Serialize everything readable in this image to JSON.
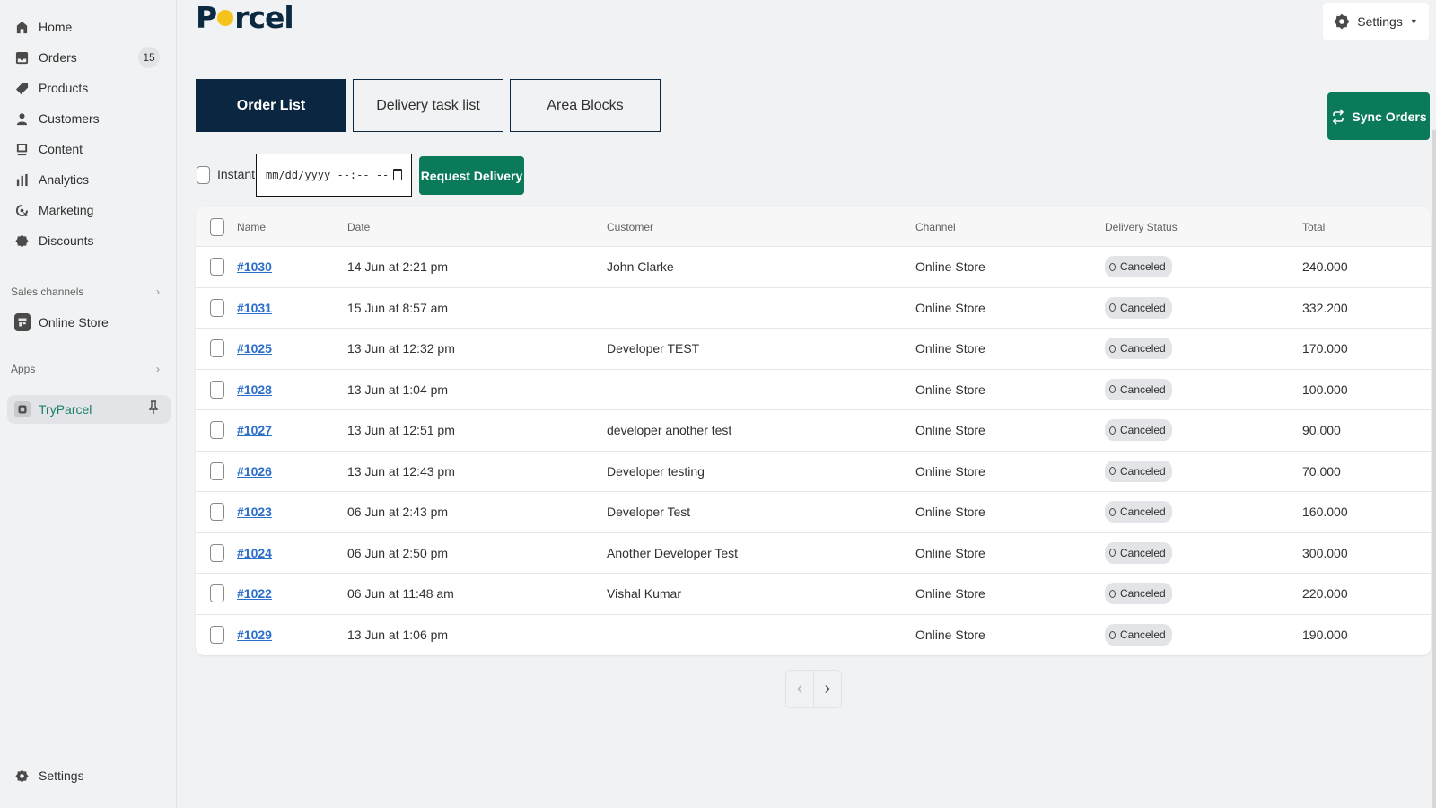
{
  "sidebar": {
    "items": [
      {
        "label": "Home",
        "icon": "home-icon"
      },
      {
        "label": "Orders",
        "icon": "orders-icon",
        "count": "15"
      },
      {
        "label": "Products",
        "icon": "tag-icon"
      },
      {
        "label": "Customers",
        "icon": "person-icon"
      },
      {
        "label": "Content",
        "icon": "content-icon"
      },
      {
        "label": "Analytics",
        "icon": "bar-chart-icon"
      },
      {
        "label": "Marketing",
        "icon": "target-icon"
      },
      {
        "label": "Discounts",
        "icon": "discount-icon"
      }
    ],
    "sales_channels_label": "Sales channels",
    "online_store_label": "Online Store",
    "apps_label": "Apps",
    "app_item_label": "TryParcel",
    "settings_label": "Settings"
  },
  "header": {
    "logo_text_before": "P",
    "logo_text_after": "rcel",
    "settings_label": "Settings"
  },
  "tabs": [
    {
      "label": "Order List",
      "active": true
    },
    {
      "label": "Delivery task list",
      "active": false
    },
    {
      "label": "Area Blocks",
      "active": false
    }
  ],
  "toolbar": {
    "sync_label": "Sync Orders",
    "instant_label": "Instant",
    "datetime_placeholder": "mm/dd/yyyy --:-- --",
    "request_label": "Request Delivery"
  },
  "table": {
    "columns": [
      "Name",
      "Date",
      "Customer",
      "Channel",
      "Delivery Status",
      "Total"
    ],
    "rows": [
      {
        "name": "#1030",
        "date": "14 Jun at 2:21 pm",
        "customer": "John Clarke",
        "channel": "Online Store",
        "status": "Canceled",
        "total": "240.000"
      },
      {
        "name": "#1031",
        "date": "15 Jun at 8:57 am",
        "customer": "",
        "channel": "Online Store",
        "status": "Canceled",
        "total": "332.200"
      },
      {
        "name": "#1025",
        "date": "13 Jun at 12:32 pm",
        "customer": "Developer TEST",
        "channel": "Online Store",
        "status": "Canceled",
        "total": "170.000"
      },
      {
        "name": "#1028",
        "date": "13 Jun at 1:04 pm",
        "customer": "",
        "channel": "Online Store",
        "status": "Canceled",
        "total": "100.000"
      },
      {
        "name": "#1027",
        "date": "13 Jun at 12:51 pm",
        "customer": "developer another test",
        "channel": "Online Store",
        "status": "Canceled",
        "total": "90.000"
      },
      {
        "name": "#1026",
        "date": "13 Jun at 12:43 pm",
        "customer": "Developer testing",
        "channel": "Online Store",
        "status": "Canceled",
        "total": "70.000"
      },
      {
        "name": "#1023",
        "date": "06 Jun at 2:43 pm",
        "customer": "Developer Test",
        "channel": "Online Store",
        "status": "Canceled",
        "total": "160.000"
      },
      {
        "name": "#1024",
        "date": "06 Jun at 2:50 pm",
        "customer": "Another Developer Test",
        "channel": "Online Store",
        "status": "Canceled",
        "total": "300.000"
      },
      {
        "name": "#1022",
        "date": "06 Jun at 11:48 am",
        "customer": "Vishal Kumar",
        "channel": "Online Store",
        "status": "Canceled",
        "total": "220.000"
      },
      {
        "name": "#1029",
        "date": "13 Jun at 1:06 pm",
        "customer": "",
        "channel": "Online Store",
        "status": "Canceled",
        "total": "190.000"
      }
    ]
  },
  "pagination": {
    "prev": "‹",
    "next": "›"
  },
  "colors": {
    "brand_dark": "#0b2640",
    "accent_green": "#0b7a5b",
    "link_blue": "#2c6ecb",
    "logo_yellow": "#f6c21c"
  }
}
